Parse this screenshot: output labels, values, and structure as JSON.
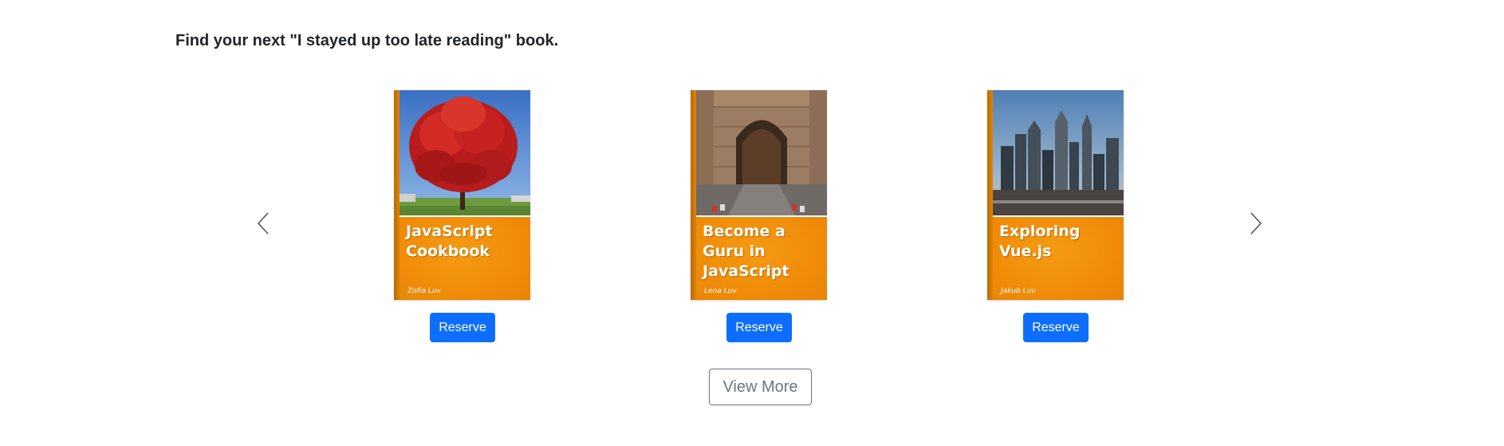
{
  "section": {
    "headline": "Find your next \"I stayed up too late reading\" book."
  },
  "carousel": {
    "prev_icon": "chevron-left-icon",
    "next_icon": "chevron-right-icon",
    "books": [
      {
        "title": "JavaScript Cookbook",
        "author": "Zofia Luv",
        "cover_theme": "red-tree",
        "reserve_label": "Reserve"
      },
      {
        "title": "Become a Guru in JavaScript",
        "author": "Lena Luv",
        "cover_theme": "stone-archway",
        "reserve_label": "Reserve"
      },
      {
        "title": "Exploring Vue.js",
        "author": "Jakub Luv",
        "cover_theme": "city-skyline",
        "reserve_label": "Reserve"
      }
    ]
  },
  "actions": {
    "view_more_label": "View More"
  },
  "colors": {
    "primary_button": "#0d6efd",
    "cover_orange": "#f08c08",
    "outline_button": "#6c757d"
  }
}
